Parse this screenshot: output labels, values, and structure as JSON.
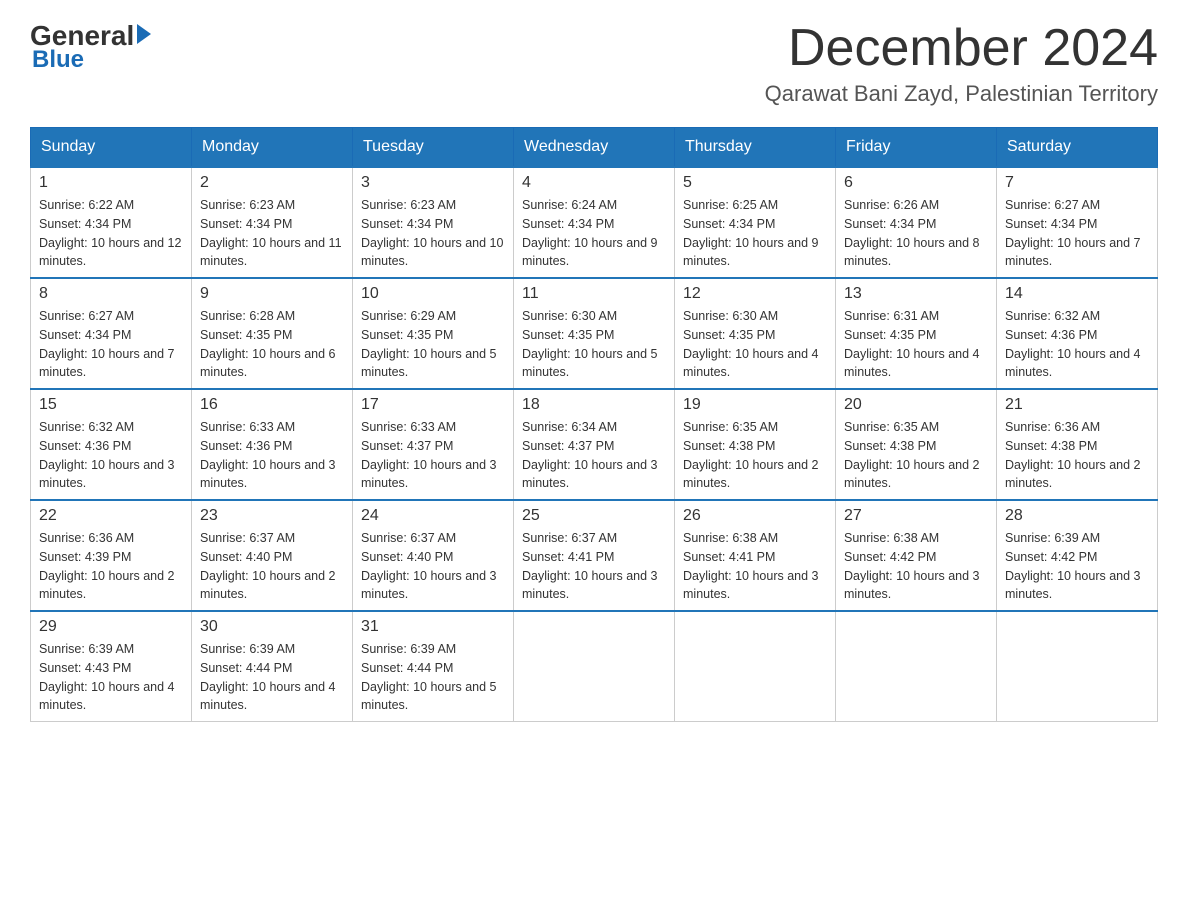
{
  "header": {
    "logo_general": "General",
    "logo_blue": "Blue",
    "month_title": "December 2024",
    "location": "Qarawat Bani Zayd, Palestinian Territory"
  },
  "days_of_week": [
    "Sunday",
    "Monday",
    "Tuesday",
    "Wednesday",
    "Thursday",
    "Friday",
    "Saturday"
  ],
  "weeks": [
    [
      {
        "day": "1",
        "sunrise": "6:22 AM",
        "sunset": "4:34 PM",
        "daylight": "10 hours and 12 minutes."
      },
      {
        "day": "2",
        "sunrise": "6:23 AM",
        "sunset": "4:34 PM",
        "daylight": "10 hours and 11 minutes."
      },
      {
        "day": "3",
        "sunrise": "6:23 AM",
        "sunset": "4:34 PM",
        "daylight": "10 hours and 10 minutes."
      },
      {
        "day": "4",
        "sunrise": "6:24 AM",
        "sunset": "4:34 PM",
        "daylight": "10 hours and 9 minutes."
      },
      {
        "day": "5",
        "sunrise": "6:25 AM",
        "sunset": "4:34 PM",
        "daylight": "10 hours and 9 minutes."
      },
      {
        "day": "6",
        "sunrise": "6:26 AM",
        "sunset": "4:34 PM",
        "daylight": "10 hours and 8 minutes."
      },
      {
        "day": "7",
        "sunrise": "6:27 AM",
        "sunset": "4:34 PM",
        "daylight": "10 hours and 7 minutes."
      }
    ],
    [
      {
        "day": "8",
        "sunrise": "6:27 AM",
        "sunset": "4:34 PM",
        "daylight": "10 hours and 7 minutes."
      },
      {
        "day": "9",
        "sunrise": "6:28 AM",
        "sunset": "4:35 PM",
        "daylight": "10 hours and 6 minutes."
      },
      {
        "day": "10",
        "sunrise": "6:29 AM",
        "sunset": "4:35 PM",
        "daylight": "10 hours and 5 minutes."
      },
      {
        "day": "11",
        "sunrise": "6:30 AM",
        "sunset": "4:35 PM",
        "daylight": "10 hours and 5 minutes."
      },
      {
        "day": "12",
        "sunrise": "6:30 AM",
        "sunset": "4:35 PM",
        "daylight": "10 hours and 4 minutes."
      },
      {
        "day": "13",
        "sunrise": "6:31 AM",
        "sunset": "4:35 PM",
        "daylight": "10 hours and 4 minutes."
      },
      {
        "day": "14",
        "sunrise": "6:32 AM",
        "sunset": "4:36 PM",
        "daylight": "10 hours and 4 minutes."
      }
    ],
    [
      {
        "day": "15",
        "sunrise": "6:32 AM",
        "sunset": "4:36 PM",
        "daylight": "10 hours and 3 minutes."
      },
      {
        "day": "16",
        "sunrise": "6:33 AM",
        "sunset": "4:36 PM",
        "daylight": "10 hours and 3 minutes."
      },
      {
        "day": "17",
        "sunrise": "6:33 AM",
        "sunset": "4:37 PM",
        "daylight": "10 hours and 3 minutes."
      },
      {
        "day": "18",
        "sunrise": "6:34 AM",
        "sunset": "4:37 PM",
        "daylight": "10 hours and 3 minutes."
      },
      {
        "day": "19",
        "sunrise": "6:35 AM",
        "sunset": "4:38 PM",
        "daylight": "10 hours and 2 minutes."
      },
      {
        "day": "20",
        "sunrise": "6:35 AM",
        "sunset": "4:38 PM",
        "daylight": "10 hours and 2 minutes."
      },
      {
        "day": "21",
        "sunrise": "6:36 AM",
        "sunset": "4:38 PM",
        "daylight": "10 hours and 2 minutes."
      }
    ],
    [
      {
        "day": "22",
        "sunrise": "6:36 AM",
        "sunset": "4:39 PM",
        "daylight": "10 hours and 2 minutes."
      },
      {
        "day": "23",
        "sunrise": "6:37 AM",
        "sunset": "4:40 PM",
        "daylight": "10 hours and 2 minutes."
      },
      {
        "day": "24",
        "sunrise": "6:37 AM",
        "sunset": "4:40 PM",
        "daylight": "10 hours and 3 minutes."
      },
      {
        "day": "25",
        "sunrise": "6:37 AM",
        "sunset": "4:41 PM",
        "daylight": "10 hours and 3 minutes."
      },
      {
        "day": "26",
        "sunrise": "6:38 AM",
        "sunset": "4:41 PM",
        "daylight": "10 hours and 3 minutes."
      },
      {
        "day": "27",
        "sunrise": "6:38 AM",
        "sunset": "4:42 PM",
        "daylight": "10 hours and 3 minutes."
      },
      {
        "day": "28",
        "sunrise": "6:39 AM",
        "sunset": "4:42 PM",
        "daylight": "10 hours and 3 minutes."
      }
    ],
    [
      {
        "day": "29",
        "sunrise": "6:39 AM",
        "sunset": "4:43 PM",
        "daylight": "10 hours and 4 minutes."
      },
      {
        "day": "30",
        "sunrise": "6:39 AM",
        "sunset": "4:44 PM",
        "daylight": "10 hours and 4 minutes."
      },
      {
        "day": "31",
        "sunrise": "6:39 AM",
        "sunset": "4:44 PM",
        "daylight": "10 hours and 5 minutes."
      },
      null,
      null,
      null,
      null
    ]
  ]
}
